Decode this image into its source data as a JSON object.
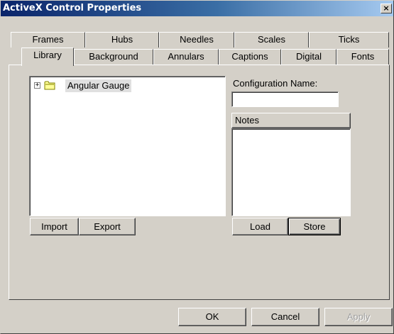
{
  "window": {
    "title": "ActiveX Control Properties",
    "close_glyph": "×"
  },
  "tabs_back": [
    "Frames",
    "Hubs",
    "Needles",
    "Scales",
    "Ticks"
  ],
  "tabs_front": [
    "Library",
    "Background",
    "Annulars",
    "Captions",
    "Digital",
    "Fonts"
  ],
  "active_tab": "Library",
  "tree": {
    "items": [
      {
        "label": "Angular Gauge",
        "icon": "folder-icon",
        "expander": "+"
      }
    ]
  },
  "buttons": {
    "import": "Import",
    "export": "Export",
    "load": "Load",
    "store": "Store",
    "ok": "OK",
    "cancel": "Cancel",
    "apply": "Apply"
  },
  "config": {
    "label": "Configuration Name:",
    "value": ""
  },
  "notes": {
    "header": "Notes",
    "value": ""
  },
  "colors": {
    "titlebar": "#0a246a",
    "face": "#d4d0c8"
  }
}
